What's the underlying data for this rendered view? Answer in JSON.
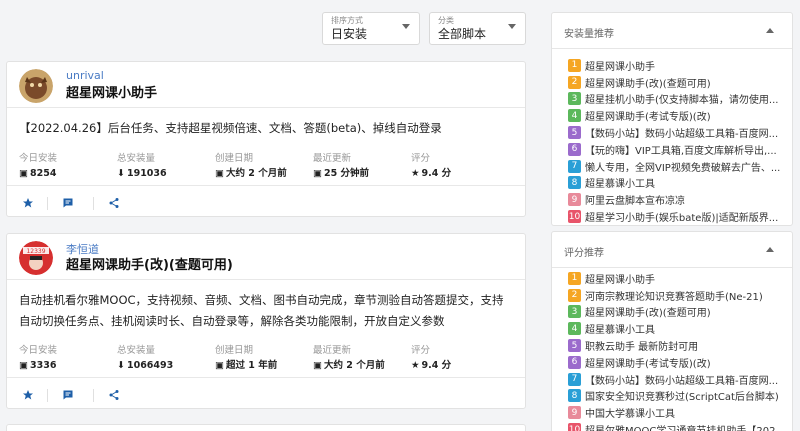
{
  "filters": {
    "sort": {
      "label": "排序方式",
      "value": "日安装"
    },
    "category": {
      "label": "分类",
      "value": "全部脚本"
    }
  },
  "scripts": [
    {
      "author": "unrival",
      "title": "超星网课小助手",
      "description": "【2022.04.26】后台任务、支持超星视频倍速、文档、答题(beta)、掉线自动登录",
      "stats": [
        {
          "label": "今日安装",
          "icon": "📅",
          "value": "8254"
        },
        {
          "label": "总安装量",
          "icon": "⬇",
          "value": "191036"
        },
        {
          "label": "创建日期",
          "icon": "📅",
          "value": "大约 2 个月前"
        },
        {
          "label": "最近更新",
          "icon": "📅",
          "value": "25 分钟前"
        },
        {
          "label": "评分",
          "icon": "★",
          "value": "9.4 分"
        }
      ]
    },
    {
      "author": "李恒道",
      "title": "超星网课助手(改)(查题可用)",
      "description": "自动挂机看尔雅MOOC，支持视频、音频、文档、图书自动完成，章节测验自动答题提交，支持自动切换任务点、挂机阅读时长、自动登录等，解除各类功能限制，开放自定义参数",
      "stats": [
        {
          "label": "今日安装",
          "icon": "📅",
          "value": "3336"
        },
        {
          "label": "总安装量",
          "icon": "⬇",
          "value": "1066493"
        },
        {
          "label": "创建日期",
          "icon": "📅",
          "value": "超过 1 年前"
        },
        {
          "label": "最近更新",
          "icon": "📅",
          "value": "大约 2 个月前"
        },
        {
          "label": "评分",
          "icon": "★",
          "value": "9.4 分"
        }
      ]
    }
  ],
  "sidebar": {
    "install_rank": {
      "title": "安装量推荐",
      "items": [
        {
          "rank": "1",
          "color": "#f5a623",
          "text": "超星网课小助手"
        },
        {
          "rank": "2",
          "color": "#f5a623",
          "text": "超星网课助手(改)(查题可用)"
        },
        {
          "rank": "3",
          "color": "#5cb85c",
          "text": "超星挂机小助手(仅支持脚本猫，请勿使用..."
        },
        {
          "rank": "4",
          "color": "#5cb85c",
          "text": "超星网课助手(考试专版)(改)"
        },
        {
          "rank": "5",
          "color": "#9b6bcc",
          "text": "【数码小站】数码小站超级工具箱-百度网..."
        },
        {
          "rank": "6",
          "color": "#9b6bcc",
          "text": "【玩的嗨】VIP工具箱,百度文库解析导出,..."
        },
        {
          "rank": "7",
          "color": "#2a9fd6",
          "text": "懒人专用，全网VIP视频免费破解去广告、..."
        },
        {
          "rank": "8",
          "color": "#2a9fd6",
          "text": "超星慕课小工具"
        },
        {
          "rank": "9",
          "color": "#e88a9a",
          "text": "阿里云盘脚本宣布凉凉"
        },
        {
          "rank": "10",
          "color": "#e8546a",
          "text": "超星学习小助手(娱乐bate版)|适配新版界..."
        }
      ]
    },
    "rating_rank": {
      "title": "评分推荐",
      "items": [
        {
          "rank": "1",
          "color": "#f5a623",
          "text": "超星网课小助手"
        },
        {
          "rank": "2",
          "color": "#f5a623",
          "text": "河南宗教理论知识竞赛答题助手(Ne-21)"
        },
        {
          "rank": "3",
          "color": "#5cb85c",
          "text": "超星网课助手(改)(查题可用)"
        },
        {
          "rank": "4",
          "color": "#5cb85c",
          "text": "超星慕课小工具"
        },
        {
          "rank": "5",
          "color": "#9b6bcc",
          "text": "职教云助手 最新防封可用"
        },
        {
          "rank": "6",
          "color": "#9b6bcc",
          "text": "超星网课助手(考试专版)(改)"
        },
        {
          "rank": "7",
          "color": "#2a9fd6",
          "text": "【数码小站】数码小站超级工具箱-百度网..."
        },
        {
          "rank": "8",
          "color": "#2a9fd6",
          "text": "国家安全知识竞赛秒过(ScriptCat后台脚本)"
        },
        {
          "rank": "9",
          "color": "#e88a9a",
          "text": "中国大学慕课小工具"
        },
        {
          "rank": "10",
          "color": "#e8546a",
          "text": "超星尔雅MOOC学习通章节挂机助手【202..."
        }
      ]
    }
  }
}
